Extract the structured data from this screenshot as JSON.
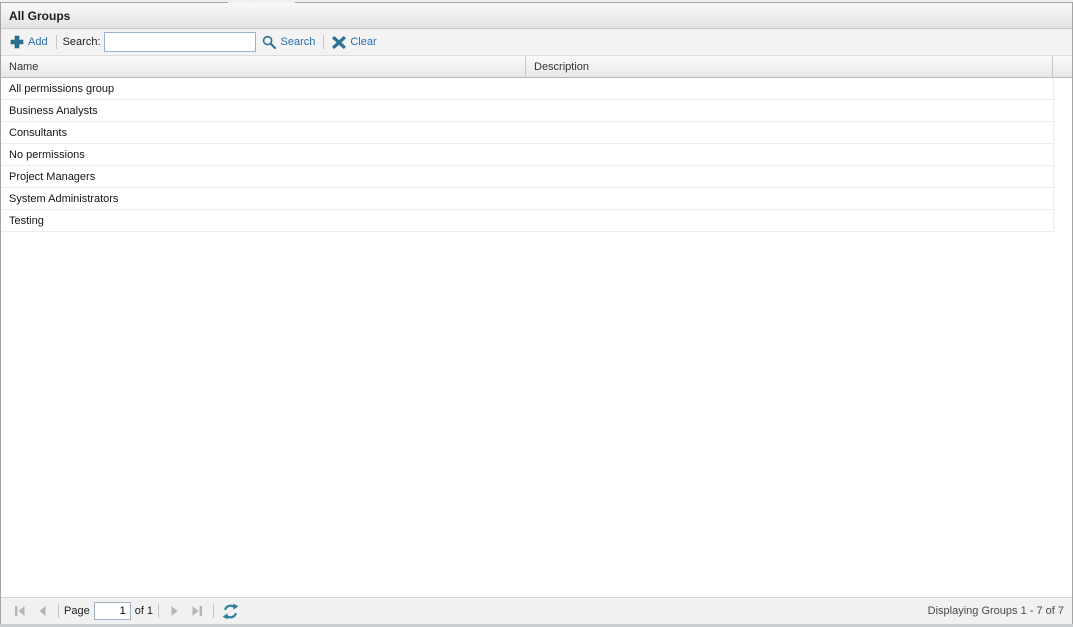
{
  "panel": {
    "title": "All Groups"
  },
  "toolbar": {
    "add_label": "Add",
    "search_label": "Search:",
    "search_value": "",
    "search_button_label": "Search",
    "clear_label": "Clear"
  },
  "grid": {
    "columns": [
      {
        "label": "Name"
      },
      {
        "label": "Description"
      }
    ],
    "rows": [
      {
        "name": "All permissions group",
        "description": ""
      },
      {
        "name": "Business Analysts",
        "description": ""
      },
      {
        "name": "Consultants",
        "description": ""
      },
      {
        "name": "No permissions",
        "description": ""
      },
      {
        "name": "Project Managers",
        "description": ""
      },
      {
        "name": "System Administrators",
        "description": ""
      },
      {
        "name": "Testing",
        "description": ""
      }
    ]
  },
  "pager": {
    "page_label": "Page",
    "page_value": "1",
    "of_label": "of 1",
    "status": "Displaying Groups 1 - 7 of 7"
  },
  "icons": {
    "add": "plus-icon",
    "search": "magnifier-icon",
    "clear": "x-icon",
    "refresh": "refresh-icon"
  },
  "colors": {
    "accent_teal": "#2B7191",
    "link_blue": "#2A6FB0",
    "disabled_gray": "#B5B5B5"
  }
}
